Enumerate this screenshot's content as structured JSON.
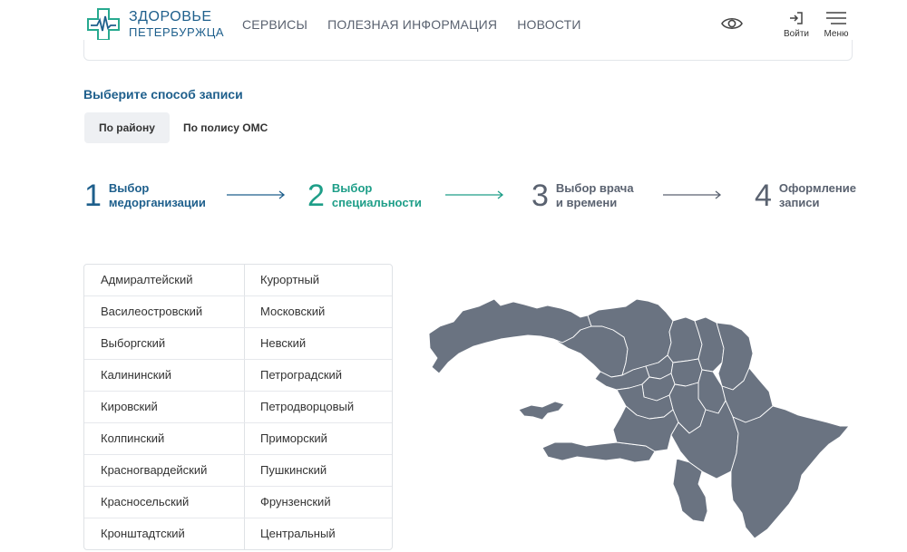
{
  "header": {
    "logo_line1": "ЗДОРОВЬЕ",
    "logo_line2": "ПЕТЕРБУРЖЦА",
    "nav": [
      "СЕРВИСЫ",
      "ПОЛЕЗНАЯ ИНФОРМАЦИЯ",
      "НОВОСТИ"
    ],
    "login_label": "Войти",
    "menu_label": "Меню",
    "icons": {
      "eye": "eye-icon",
      "login": "login-icon",
      "menu": "menu-icon"
    }
  },
  "booking": {
    "title": "Выберите способ записи",
    "modes": [
      {
        "label": "По району",
        "selected": true
      },
      {
        "label": "По полису ОМС",
        "selected": false
      }
    ]
  },
  "steps": [
    {
      "num": "1",
      "label1": "Выбор",
      "label2": "медорганизации",
      "color": "#1e5f8c"
    },
    {
      "num": "2",
      "label1": "Выбор",
      "label2": "специальности",
      "color": "#1e9e88"
    },
    {
      "num": "3",
      "label1": "Выбор врача",
      "label2": "и времени",
      "color": "#5a6270"
    },
    {
      "num": "4",
      "label1": "Оформление",
      "label2": "записи",
      "color": "#5a6270"
    }
  ],
  "districts": {
    "left": [
      "Адмиралтейский",
      "Василеостровский",
      "Выборгский",
      "Калининский",
      "Кировский",
      "Колпинский",
      "Красногвардейский",
      "Красносельский",
      "Кронштадтский"
    ],
    "right": [
      "Курортный",
      "Московский",
      "Невский",
      "Петроградский",
      "Петродворцовый",
      "Приморский",
      "Пушкинский",
      "Фрунзенский",
      "Центральный"
    ]
  },
  "colors": {
    "brand": "#1e5f8c",
    "accent": "#1e9e88",
    "map_fill": "#6a7381",
    "map_stroke": "#ffffff"
  }
}
